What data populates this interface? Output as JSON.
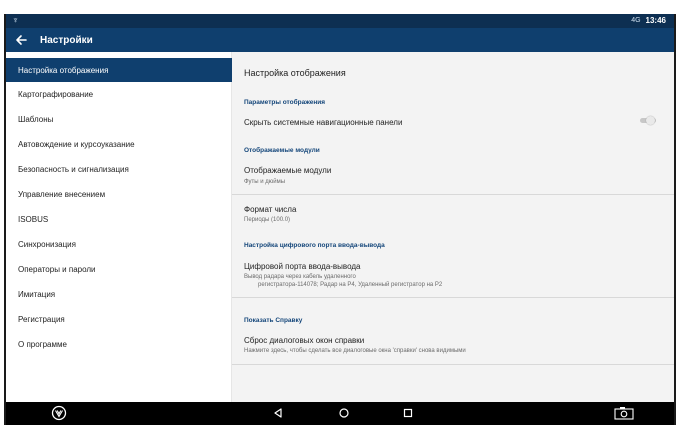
{
  "statusbar": {
    "signal": "4G",
    "time": "13:46"
  },
  "appbar": {
    "title": "Настройки"
  },
  "sidebar": {
    "items": [
      {
        "label": "Настройка отображения"
      },
      {
        "label": "Картографирование"
      },
      {
        "label": "Шаблоны"
      },
      {
        "label": "Автовождение и курсоуказание"
      },
      {
        "label": "Безопасность и сигнализация"
      },
      {
        "label": "Управление внесением"
      },
      {
        "label": "ISOBUS"
      },
      {
        "label": "Синхронизация"
      },
      {
        "label": "Операторы и пароли"
      },
      {
        "label": "Имитация"
      },
      {
        "label": "Регистрация"
      },
      {
        "label": "О программе"
      }
    ]
  },
  "detail": {
    "title": "Настройка отображения",
    "display_params": {
      "header": "Параметры отображения",
      "hide_nav_label": "Скрыть системные навигационные панели",
      "hide_nav_enabled": false
    },
    "modules": {
      "header": "Отображаемые модули",
      "title": "Отображаемые модули",
      "sub": "Футы и дюймы"
    },
    "number_format": {
      "title": "Формат числа",
      "sub": "Периоды (100.0)"
    },
    "digital_port": {
      "header": "Настройка цифрового порта ввода-вывода",
      "title": "Цифровой порта ввода-вывода",
      "sub_line1": "Вывод радара через кабель удаленного",
      "sub_line2": "регистратора-114078; Радар на P4, Удаленный регистратор на P2"
    },
    "help": {
      "header": "Показать Справку",
      "title": "Сброс диалоговых окон справки",
      "sub": "Нажмите здесь, чтобы сделать все диалоговые окна 'справки' снова видимыми"
    }
  },
  "colors": {
    "appbar": "#0f3f6e",
    "statusbar": "#0d2f52",
    "section_header": "#14467a",
    "active_item": "#0f3f6e"
  }
}
